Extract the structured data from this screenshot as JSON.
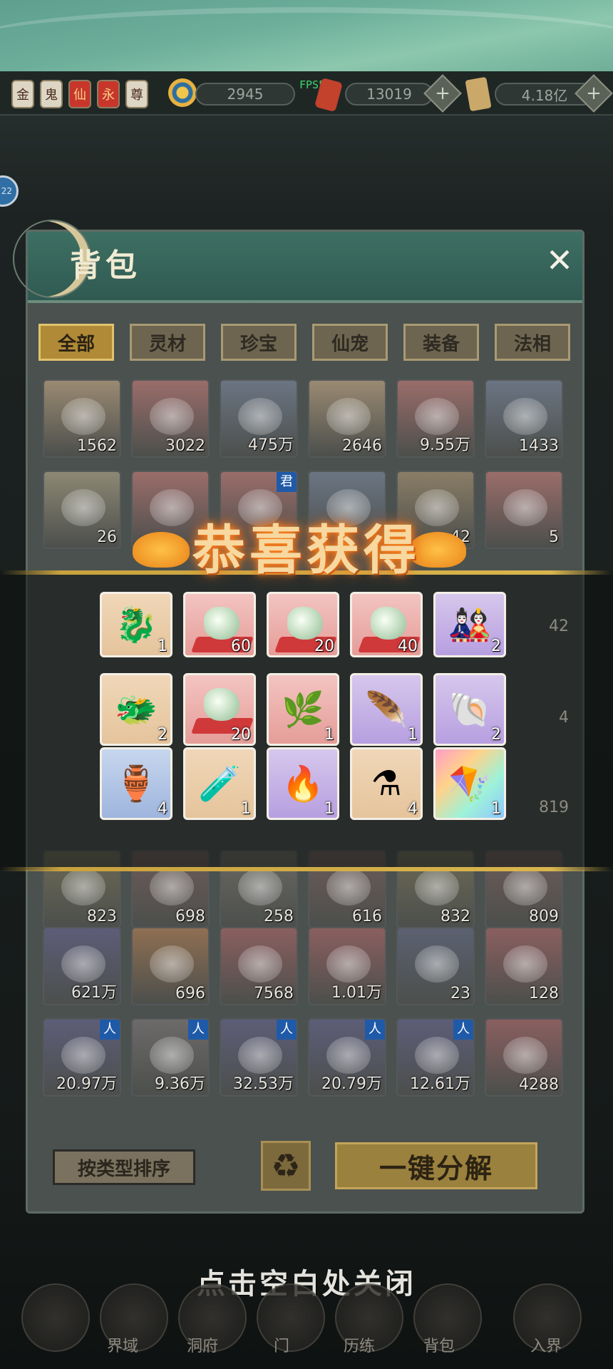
{
  "resources": {
    "badges": [
      "金",
      "鬼",
      "仙",
      "永",
      "尊"
    ],
    "spirit_stones": "2945",
    "fps": "FPS56",
    "currency_2": "13019",
    "currency_3": "4.18亿"
  },
  "side_chip": "22",
  "panel": {
    "title": "背包",
    "close": "✕"
  },
  "tabs": [
    "全部",
    "灵材",
    "珍宝",
    "仙宠",
    "装备",
    "法相"
  ],
  "bag_rows": [
    [
      {
        "count": "1562",
        "color": "#9a8a72"
      },
      {
        "count": "3022",
        "color": "#9a6d6a"
      },
      {
        "count": "475万",
        "color": "#6b7583"
      },
      {
        "count": "2646",
        "color": "#9a8a72"
      },
      {
        "count": "9.55万",
        "color": "#9a6d6a"
      },
      {
        "count": "1433",
        "color": "#6b7583"
      }
    ],
    [
      {
        "count": "26",
        "color": "#8d8874"
      },
      {
        "count": "",
        "color": "#9a6d6a"
      },
      {
        "count": "",
        "color": "#9a6d6a",
        "tag": "君"
      },
      {
        "count": "",
        "color": "#6b7583"
      },
      {
        "count": "42",
        "color": "#8a7d66"
      },
      {
        "count": "5",
        "color": "#9a6d6a"
      }
    ],
    [
      {
        "count": "823",
        "color": "#6d6a55"
      },
      {
        "count": "698",
        "color": "#6d5b58"
      },
      {
        "count": "258",
        "color": "#6a6862"
      },
      {
        "count": "616",
        "color": "#6d5b58"
      },
      {
        "count": "832",
        "color": "#6d6a55"
      },
      {
        "count": "809",
        "color": "#6d5b58"
      }
    ],
    [
      {
        "count": "621万",
        "color": "#5d5d78"
      },
      {
        "count": "696",
        "color": "#8f6f52"
      },
      {
        "count": "7568",
        "color": "#8a5f5f"
      },
      {
        "count": "1.01万",
        "color": "#8a5f5f"
      },
      {
        "count": "23",
        "color": "#5b6171"
      },
      {
        "count": "128",
        "color": "#8a5f5f"
      }
    ],
    [
      {
        "count": "20.97万",
        "color": "#5d5d78",
        "tag": "人"
      },
      {
        "count": "9.36万",
        "color": "#6d6a6a",
        "tag": "人"
      },
      {
        "count": "32.53万",
        "color": "#5d5d78",
        "tag": "人"
      },
      {
        "count": "20.79万",
        "color": "#5d5d78",
        "tag": "人"
      },
      {
        "count": "12.61万",
        "color": "#5d5d78",
        "tag": "人"
      },
      {
        "count": "4288",
        "color": "#8a5f5f"
      }
    ]
  ],
  "side_counts": [
    "42",
    "4",
    "819"
  ],
  "reward_popup": {
    "title": "恭喜获得",
    "items": [
      [
        {
          "count": "1",
          "bg": "orange",
          "icon": "🐉"
        },
        {
          "count": "60",
          "bg": "red",
          "icon": "stone"
        },
        {
          "count": "20",
          "bg": "red",
          "icon": "stone"
        },
        {
          "count": "40",
          "bg": "red",
          "icon": "stone"
        },
        {
          "count": "2",
          "bg": "purple",
          "icon": "🎎"
        }
      ],
      [
        {
          "count": "2",
          "bg": "orange",
          "icon": "🐲"
        },
        {
          "count": "20",
          "bg": "red",
          "icon": "stone"
        },
        {
          "count": "1",
          "bg": "red",
          "icon": "🌿"
        },
        {
          "count": "1",
          "bg": "purple",
          "icon": "🪶"
        },
        {
          "count": "2",
          "bg": "purple",
          "icon": "🐚"
        }
      ],
      [
        {
          "count": "4",
          "bg": "blue",
          "icon": "🏺"
        },
        {
          "count": "1",
          "bg": "orange",
          "icon": "🧪"
        },
        {
          "count": "1",
          "bg": "purple",
          "icon": "🔥"
        },
        {
          "count": "4",
          "bg": "orange",
          "icon": "⚗"
        },
        {
          "count": "1",
          "bg": "rainbow",
          "icon": "🪁"
        }
      ]
    ]
  },
  "buttons": {
    "sort": "按类型排序",
    "recycle": "♻",
    "decompose": "一键分解"
  },
  "close_hint": "点击空白处关闭",
  "bottom_nav": [
    "界域",
    "洞府",
    "门",
    "历练",
    "背包",
    "入界"
  ]
}
